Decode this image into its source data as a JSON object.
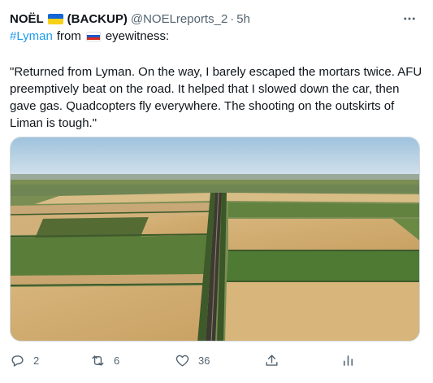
{
  "tweet": {
    "display_name": "NOËL",
    "name_suffix": "(BACKUP)",
    "handle": "@NOELreports_2",
    "separator": "·",
    "time": "5h",
    "more_icon": "more-horizontal-icon",
    "hashtag": "#Lyman",
    "from_text": "from",
    "eyewitness_text": "eyewitness:",
    "body": "\"Returned from Lyman. On the way, I barely escaped the mortars twice. AFU preemptively beat on the road. It helped that I slowed down the car, then gave gas. Quadcopters fly everywhere. The shooting on the outskirts of Liman is tough.\"",
    "flags": {
      "name_flag": "ukraine-flag-icon",
      "source_flag": "russia-flag-icon"
    },
    "image": {
      "kind": "aerial-photo-farm-fields-road"
    }
  },
  "actions": {
    "reply": {
      "icon": "reply-icon",
      "count": "2"
    },
    "retweet": {
      "icon": "retweet-icon",
      "count": "6"
    },
    "like": {
      "icon": "heart-icon",
      "count": "36"
    },
    "share": {
      "icon": "share-icon"
    },
    "stats": {
      "icon": "analytics-icon"
    }
  },
  "colors": {
    "accent": "#1d9bf0",
    "secondary_text": "#536471",
    "text": "#0f1419"
  }
}
